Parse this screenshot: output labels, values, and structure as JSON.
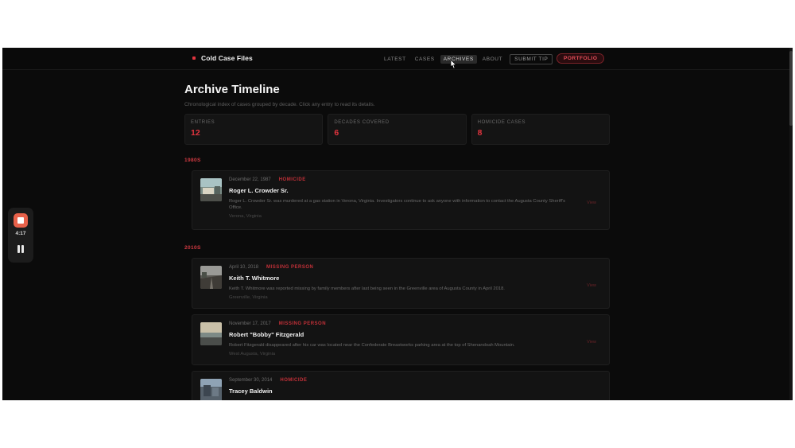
{
  "brand": {
    "name": "Cold Case Files"
  },
  "nav": {
    "items": [
      "LATEST",
      "CASES",
      "ARCHIVES",
      "ABOUT"
    ],
    "submit_tip": "SUBMIT TIP",
    "portfolio": "PORTFOLIO"
  },
  "page": {
    "title": "Archive Timeline",
    "subtitle": "Chronological index of cases grouped by decade. Click any entry to read its details."
  },
  "stats": [
    {
      "label": "ENTRIES",
      "value": "12"
    },
    {
      "label": "DECADES COVERED",
      "value": "6"
    },
    {
      "label": "HOMICIDE CASES",
      "value": "8"
    }
  ],
  "decades": [
    {
      "label": "1980S",
      "entries": [
        {
          "date": "December 22, 1987",
          "tag": "HOMICIDE",
          "name": "Roger L. Crowder Sr.",
          "description": "Roger L. Crowder Sr. was murdered at a gas station in Verona, Virginia. Investigators continue to ask anyone with information to contact the Augusta County Sheriff's Office.",
          "location": "Verona, Virginia",
          "view": "View"
        }
      ]
    },
    {
      "label": "2010S",
      "entries": [
        {
          "date": "April 10, 2018",
          "tag": "MISSING PERSON",
          "name": "Keith T. Whitmore",
          "description": "Keith T. Whitmore was reported missing by family members after last being seen in the Greenville area of Augusta County in April 2018.",
          "location": "Greenville, Virginia",
          "view": "View"
        },
        {
          "date": "November 17, 2017",
          "tag": "MISSING PERSON",
          "name": "Robert \"Bobby\" Fitzgerald",
          "description": "Robert Fitzgerald disappeared after his car was located near the Confederate Breastworks parking area at the top of Shenandoah Mountain.",
          "location": "West Augusta, Virginia",
          "view": "View"
        },
        {
          "date": "September 30, 2014",
          "tag": "HOMICIDE",
          "name": "Tracey Baldwin",
          "description": "",
          "location": "",
          "view": ""
        }
      ]
    }
  ],
  "recorder": {
    "time": "4:17"
  },
  "colors": {
    "accent": "#e0343e",
    "background": "#0b0b0b",
    "card": "#131313"
  }
}
